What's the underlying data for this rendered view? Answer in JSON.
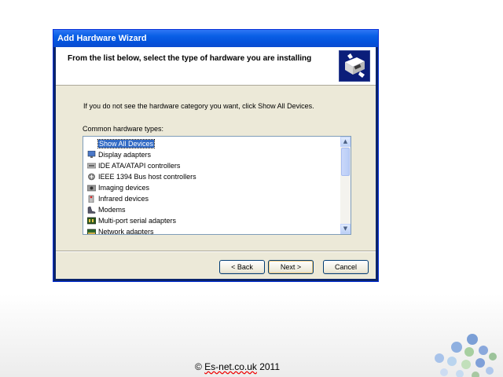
{
  "window": {
    "title": "Add Hardware Wizard",
    "header_title": "From the list below, select the type of hardware you are installing",
    "header_icon": "hardware-wizard-icon"
  },
  "content": {
    "instruction": "If you do not see the hardware category you want, click Show All Devices.",
    "list_label": "Common hardware types:",
    "items": [
      {
        "label": "Show All Devices",
        "icon": "none",
        "selected": true
      },
      {
        "label": "Display adapters",
        "icon": "display-adapter-icon"
      },
      {
        "label": "IDE ATA/ATAPI controllers",
        "icon": "ide-controller-icon"
      },
      {
        "label": "IEEE 1394 Bus host controllers",
        "icon": "ieee1394-icon"
      },
      {
        "label": "Imaging devices",
        "icon": "camera-icon"
      },
      {
        "label": "Infrared devices",
        "icon": "infrared-icon"
      },
      {
        "label": "Modems",
        "icon": "modem-icon"
      },
      {
        "label": "Multi-port serial adapters",
        "icon": "serial-adapter-icon"
      },
      {
        "label": "Network adapters",
        "icon": "network-adapter-icon"
      }
    ]
  },
  "buttons": {
    "back": "< Back",
    "next": "Next >",
    "cancel": "Cancel"
  },
  "footer": {
    "copyright_prefix": "© ",
    "copyright_site": "Es-net.co.uk",
    "copyright_year": " 2011"
  }
}
